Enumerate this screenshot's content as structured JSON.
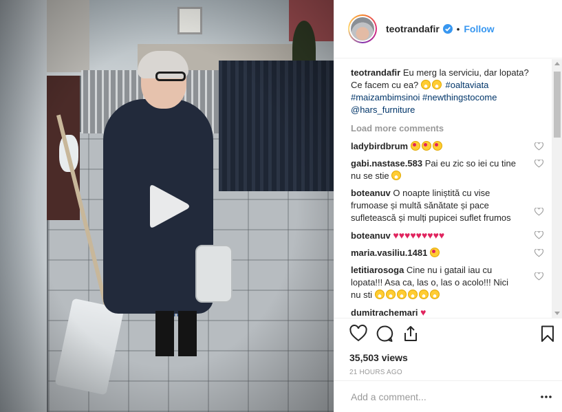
{
  "post": {
    "username": "teotrandafir",
    "separator": "•",
    "follow_label": "Follow",
    "verified_icon": "verified-badge-icon",
    "accent_color": "#3897f0"
  },
  "video": {
    "play_icon": "play-icon"
  },
  "caption": {
    "username": "teotrandafir",
    "text": "Eu merg la serviciu, dar lopata? Ce facem cu ea?",
    "hashtags": [
      "#oaltaviata",
      "#maizambimsinoi",
      "#newthingstocome"
    ],
    "mention": "@hars_furniture"
  },
  "load_more": "Load more comments",
  "comments": [
    {
      "username": "ladybirdbrum",
      "text": ""
    },
    {
      "username": "gabi.nastase.583",
      "text": "Pai eu zic so iei cu tine nu se stie"
    },
    {
      "username": "boteanuv",
      "text": "O noapte liniștită cu vise frumoase și multă sănătate și pace sufletească și mulți pupicei suflet frumos"
    },
    {
      "username": "boteanuv",
      "text": ""
    },
    {
      "username": "maria.vasiliu.1481",
      "text": ""
    },
    {
      "username": "letitiarosoga",
      "text": "Cine nu i gatail iau cu lopata!!! Asa ca, las o, las o acolo!!! Nici nu sti"
    },
    {
      "username": "dumitrachemari",
      "text": ""
    }
  ],
  "stats": {
    "views": "35,503 views",
    "time": "21 HOURS AGO"
  },
  "add_comment": {
    "placeholder": "Add a comment..."
  }
}
